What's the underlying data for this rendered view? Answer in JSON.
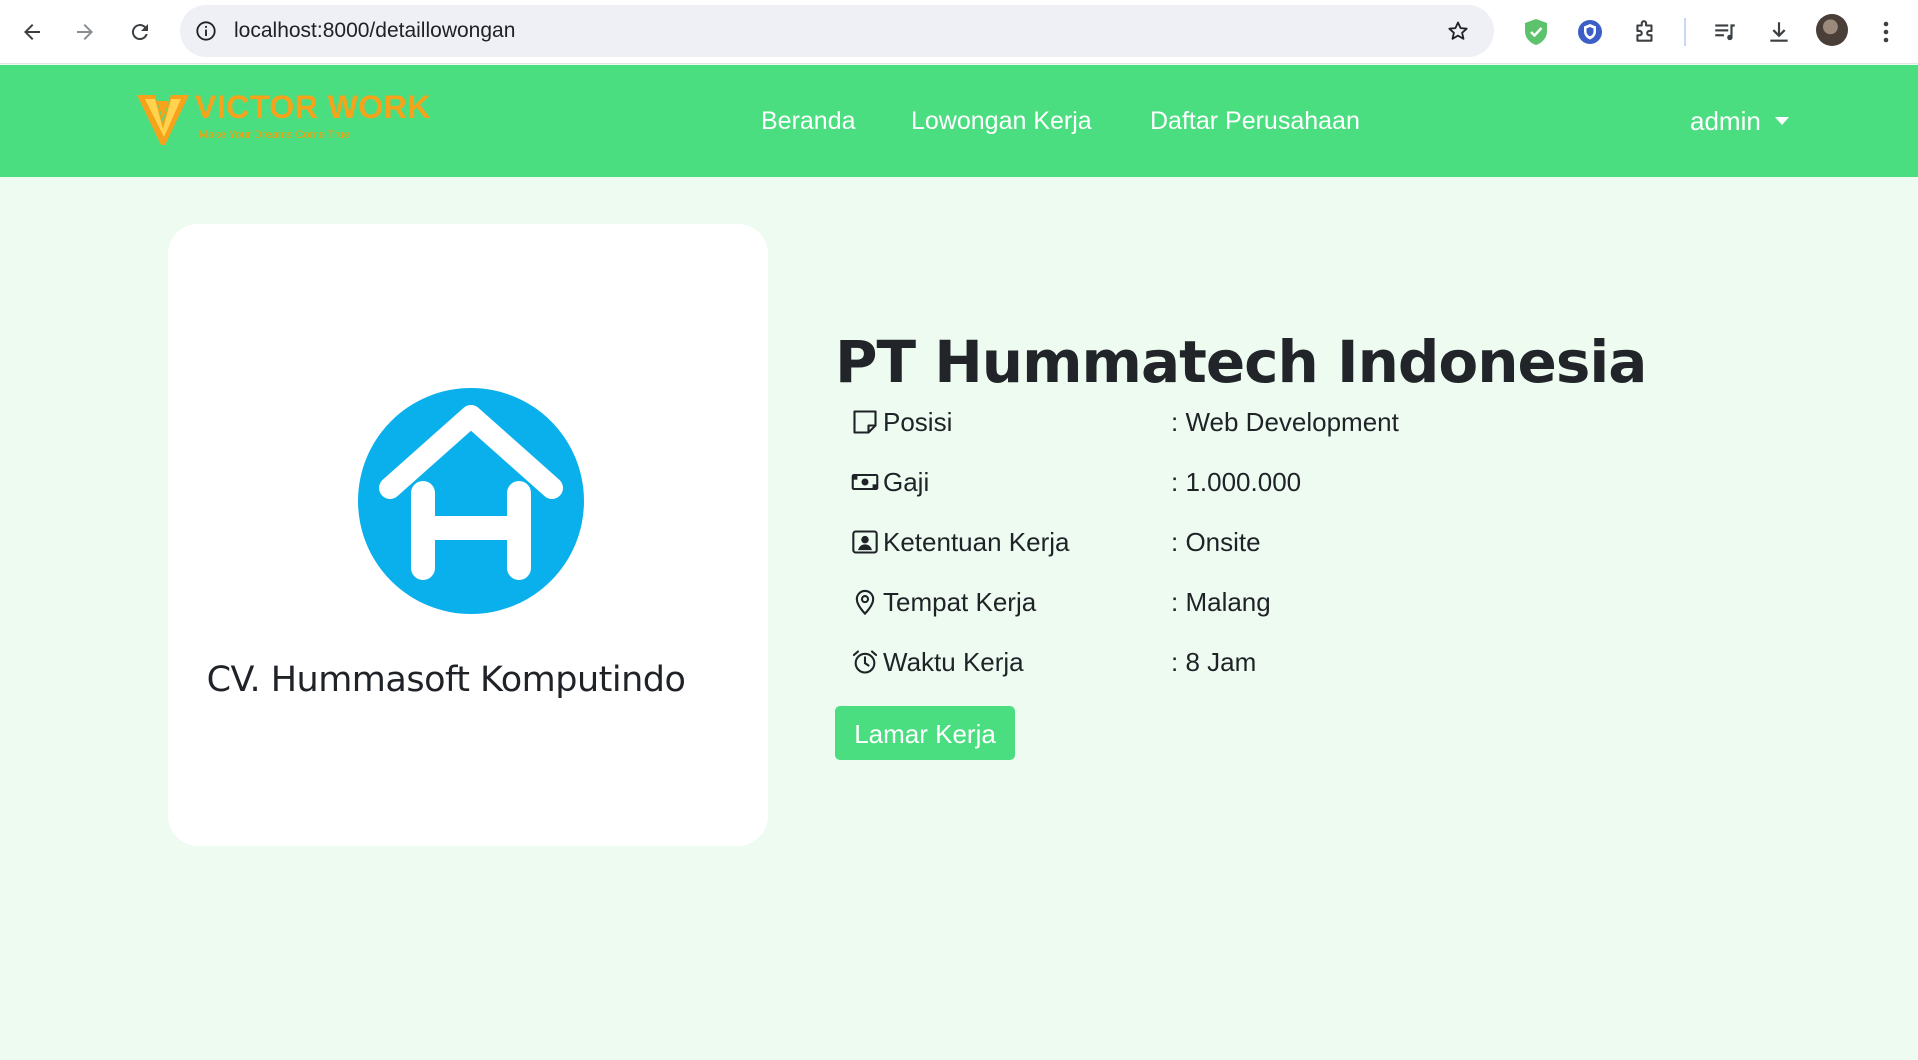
{
  "browser": {
    "url": "localhost:8000/detaillowongan",
    "icons": [
      "back-icon",
      "forward-icon",
      "reload-icon",
      "site-info-icon",
      "bookmark-star-icon",
      "shield-extension-icon",
      "vpn-extension-icon",
      "extensions-puzzle-icon",
      "media-controls-icon",
      "downloads-icon",
      "profile-avatar",
      "kebab-menu-icon"
    ]
  },
  "navbar": {
    "brand_name": "VICTOR WORK",
    "brand_tagline": "Make Your Dreams Come True",
    "menu": [
      {
        "label": "Beranda"
      },
      {
        "label": "Lowongan Kerja"
      },
      {
        "label": "Daftar Perusahaan"
      }
    ],
    "user": "admin",
    "colors": {
      "background": "#4ade80",
      "brand": "#f7a21b"
    }
  },
  "logo_card": {
    "caption": "CV. Hummasoft Komputindo",
    "logo_color": "#0ab0ec"
  },
  "detail": {
    "company_name": "PT Hummatech Indonesia",
    "rows": [
      {
        "icon": "sticky-note-icon",
        "label": "Posisi",
        "value": ": Web Development"
      },
      {
        "icon": "cash-icon",
        "label": "Gaji",
        "value": ": 1.000.000"
      },
      {
        "icon": "person-badge-icon",
        "label": "Ketentuan Kerja",
        "value": ": Onsite"
      },
      {
        "icon": "location-pin-icon",
        "label": "Tempat Kerja",
        "value": ": Malang"
      },
      {
        "icon": "alarm-clock-icon",
        "label": "Waktu Kerja",
        "value": ": 8 Jam"
      }
    ],
    "apply_label": "Lamar Kerja"
  }
}
